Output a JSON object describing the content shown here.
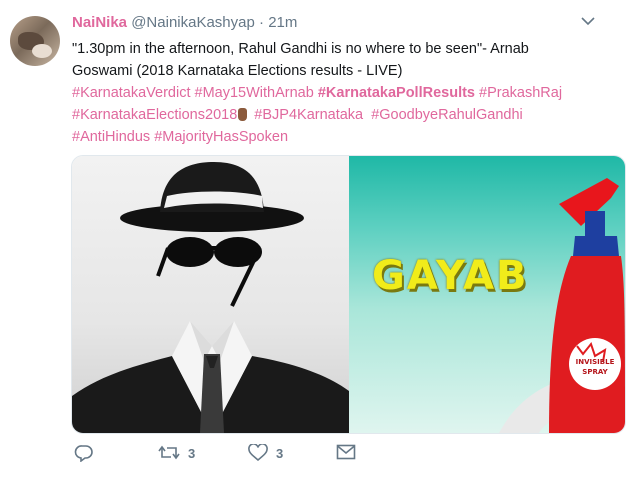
{
  "tweet": {
    "display_name": "NaiNika",
    "handle": "@NainikaKashyap",
    "separator": "·",
    "timestamp": "21m",
    "text_line1": "\"1.30pm in the afternoon, Rahul Gandhi is no where to be seen\"- Arnab",
    "text_line2": "Goswami  (2018 Karnataka Elections results - LIVE)",
    "hashtags": {
      "karnataka_verdict": "#KarnatakaVerdict",
      "may15_with_arnab": "#May15WithArnab",
      "karnataka_poll_results": "#KarnatakaPollResults",
      "prakash_raj": "#PrakashRaj",
      "karnataka_elections_2018": "#KarnatakaElections2018",
      "bjp4karnataka": "#BJP4Karnataka",
      "goodbye_rahul_gandhi": "#GoodbyeRahulGandhi",
      "anti_hindus": "#AntiHindus",
      "majority_has_spoken": "#MajorityHasSpoken"
    },
    "media": {
      "right_caption": "GAYAB",
      "bottle_label_line1": "INVISIBLE",
      "bottle_label_line2": "SPRAY"
    },
    "actions": {
      "reply_icon": "reply-icon",
      "retweet_icon": "retweet-icon",
      "retweet_count": "3",
      "like_icon": "heart-icon",
      "like_count": "3",
      "dm_icon": "envelope-icon"
    }
  },
  "colors": {
    "accent": "#e0689d",
    "muted": "#657786",
    "text": "#14171a"
  }
}
